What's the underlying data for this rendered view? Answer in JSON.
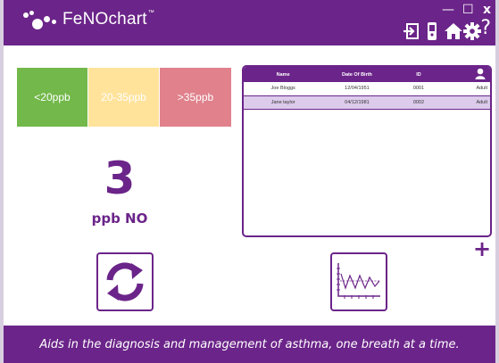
{
  "app": {
    "brand": "FeNOchart",
    "brand_tm": "™"
  },
  "window_controls": {
    "minimize": "—",
    "maximize": "☐",
    "close": "x"
  },
  "header_icons": [
    "logout-icon",
    "device-icon",
    "home-icon",
    "settings-icon",
    "help-icon"
  ],
  "help_label": "?",
  "ranges": [
    {
      "label": "<20ppb",
      "color": "#72b84a"
    },
    {
      "label": "20-35ppb",
      "color": "#ffe39b"
    },
    {
      "label": ">35ppb",
      "color": "#e0818c"
    }
  ],
  "reading": {
    "value": "3",
    "unit": "ppb NO"
  },
  "patient_table": {
    "headers": [
      "Name",
      "Date Of Birth",
      "ID"
    ],
    "rows": [
      {
        "name": "Joe Bloggs",
        "dob": "12/04/1951",
        "id": "0001",
        "type": "Adult"
      },
      {
        "name": "Jane taylor",
        "dob": "04/12/1981",
        "id": "0002",
        "type": "Adult"
      }
    ]
  },
  "add_label": "+",
  "footer": {
    "tagline": "Aids in the diagnosis and management of asthma, one breath at a time."
  },
  "colors": {
    "brand": "#6b2489",
    "selected_row": "#dccbeb"
  }
}
